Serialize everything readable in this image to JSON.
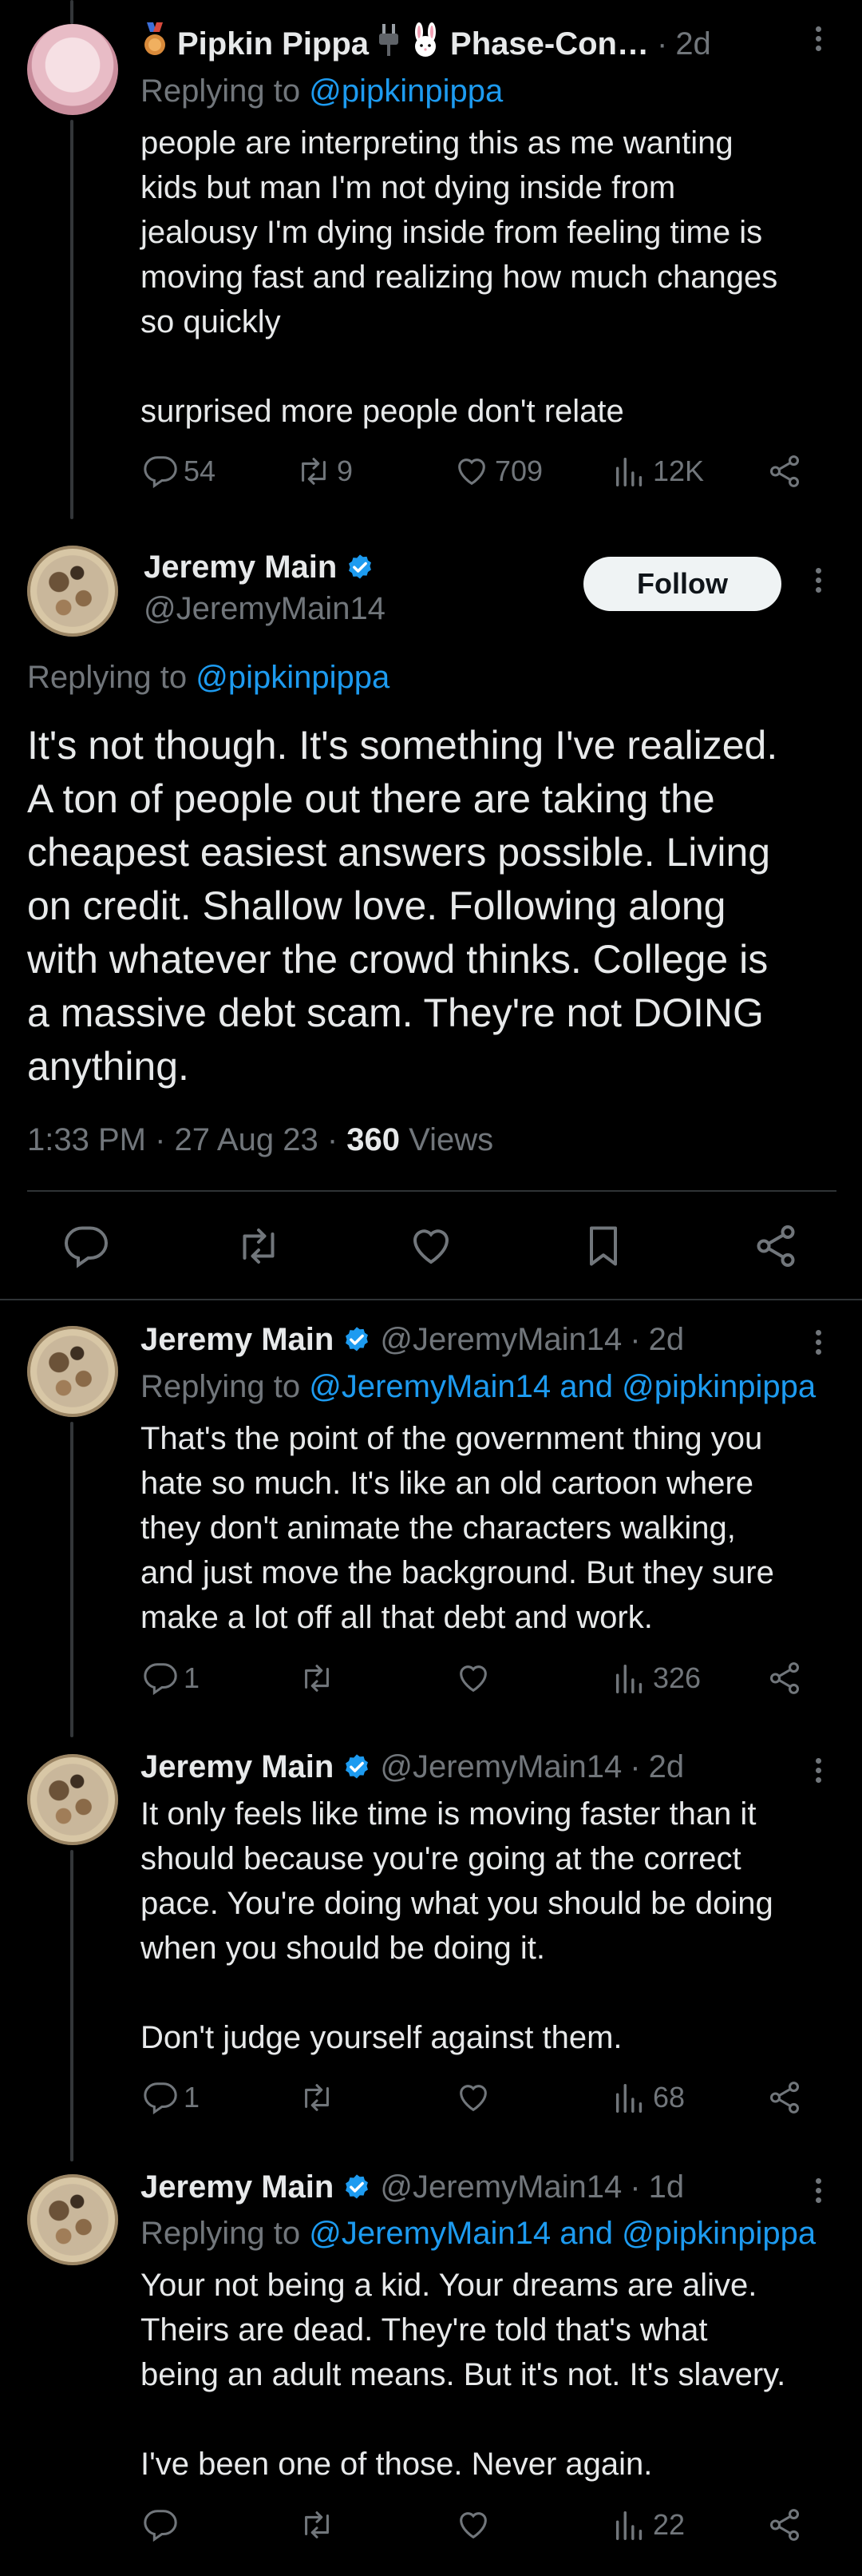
{
  "post1": {
    "name": "Pipkin Pippa",
    "name_suffix": "Phase-Con…",
    "time": "2d",
    "reply_prefix": "Replying to ",
    "reply_mention": "@pipkinpippa",
    "text": "people are interpreting this as me wanting\nkids but man I'm not dying inside from\njealousy I'm dying inside from feeling time is\nmoving fast and realizing how much changes\nso quickly\n\nsurprised more people don't relate",
    "replies": "54",
    "reposts": "9",
    "likes": "709",
    "views": "12K"
  },
  "main_post": {
    "name": "Jeremy Main",
    "handle": "@JeremyMain14",
    "follow_label": "Follow",
    "reply_prefix": "Replying to ",
    "reply_mention": "@pipkinpippa",
    "text": "It's not though. It's something I've realized.\nA ton of people out there are taking the\ncheapest easiest answers possible. Living\non credit. Shallow love. Following along\nwith whatever the crowd thinks. College is\na massive debt scam. They're not DOING\nanything.",
    "time": "1:33 PM",
    "date": "27 Aug 23",
    "views_count": "360",
    "views_label": "Views"
  },
  "reply1": {
    "name": "Jeremy Main",
    "handle": "@JeremyMain14",
    "time": "2d",
    "reply_prefix": "Replying to ",
    "reply_mention": "@JeremyMain14 and @pipkinpippa",
    "text": "That's the point of the government thing you\nhate so much. It's like an old cartoon where\nthey don't animate the characters walking,\nand just move the background. But they sure\nmake a lot off all that debt and work.",
    "replies": "1",
    "views": "326"
  },
  "reply2": {
    "name": "Jeremy Main",
    "handle": "@JeremyMain14",
    "time": "2d",
    "text": "It only feels like time is moving faster than it\nshould because you're going at the correct\npace. You're doing what you should be doing\nwhen you should be doing it.\n\nDon't judge yourself against them.",
    "replies": "1",
    "views": "68"
  },
  "reply3": {
    "name": "Jeremy Main",
    "handle": "@JeremyMain14",
    "time": "1d",
    "reply_prefix": "Replying to ",
    "reply_mention": "@JeremyMain14 and @pipkinpippa",
    "text": "Your not being a kid. Your dreams are alive.\nTheirs are dead. They're told that's what\nbeing an adult means. But it's not. It's slavery.\n\nI've been one of those. Never again.",
    "views": "22"
  },
  "colors": {
    "background": "#000000",
    "text": "#e7e9ea",
    "secondary": "#71767b",
    "link": "#1d9bf0",
    "verified": "#1d9bf0",
    "divider": "#2f3336"
  }
}
